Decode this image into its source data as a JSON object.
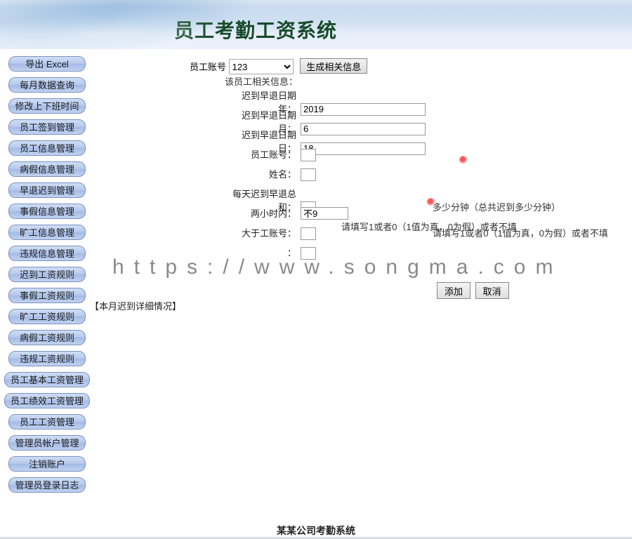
{
  "header": {
    "title": "员工考勤工资系统"
  },
  "sidebar": {
    "items": [
      {
        "label": "导出 Excel",
        "wide": false
      },
      {
        "label": "每月数据查询",
        "wide": false
      },
      {
        "label": "修改上下班时间",
        "wide": false
      },
      {
        "label": "员工签到管理",
        "wide": false
      },
      {
        "label": "员工信息管理",
        "wide": false
      },
      {
        "label": "病假信息管理",
        "wide": false
      },
      {
        "label": "早退迟到管理",
        "wide": false
      },
      {
        "label": "事假信息管理",
        "wide": false
      },
      {
        "label": "旷工信息管理",
        "wide": false
      },
      {
        "label": "违规信息管理",
        "wide": false
      },
      {
        "label": "迟到工资规则",
        "wide": false
      },
      {
        "label": "事假工资规则",
        "wide": false
      },
      {
        "label": "旷工工资规则",
        "wide": false
      },
      {
        "label": "病假工资规则",
        "wide": false
      },
      {
        "label": "违规工资规则",
        "wide": false
      },
      {
        "label": "员工基本工资管理",
        "wide": true
      },
      {
        "label": "员工绩效工资管理",
        "wide": true
      },
      {
        "label": "员工工资管理",
        "wide": false
      },
      {
        "label": "管理员帐户管理",
        "wide": false
      },
      {
        "label": "注销账户",
        "wide": false
      },
      {
        "label": "管理员登录日志",
        "wide": false
      }
    ]
  },
  "top": {
    "account_label": "员工账号",
    "account_value": "123",
    "generate_btn": "生成相关信息"
  },
  "info_line": "该员工相关信息：",
  "form": {
    "rows": [
      {
        "label": "迟到早退日期年：",
        "value": "2019",
        "cls": "w-wide",
        "hint": ""
      },
      {
        "label": "迟到早退日期月：",
        "value": "6",
        "cls": "w-wide",
        "hint": ""
      },
      {
        "label": "迟到早退日期日：",
        "value": "18",
        "cls": "w-wide",
        "hint": ""
      },
      {
        "label": "员工账号：",
        "value": "",
        "cls": "w-small",
        "hint": ""
      },
      {
        "label": "姓名：",
        "value": "",
        "cls": "w-small",
        "hint": ""
      },
      {
        "label": "每天迟到早退总和：",
        "value": "",
        "cls": "w-small",
        "hint": "多少分钟（总共迟到多少分钟）"
      },
      {
        "label": "两小时内：",
        "value": "不9",
        "cls": "w-med",
        "hint": "请填写1或者0（1值为真，0为假）或者不填"
      },
      {
        "label": "大于工账号：",
        "value": "",
        "cls": "w-small",
        "hint": "请填写1或者0（1值为真，0为假）或者不填"
      },
      {
        "label": "：",
        "value": "",
        "cls": "w-small",
        "hint": ""
      }
    ]
  },
  "actions": {
    "add": "添加",
    "cancel": "取消"
  },
  "section_title": "【本月迟到详细情况】",
  "watermark": "https://www.songma.com",
  "footer": "某某公司考勤系统"
}
